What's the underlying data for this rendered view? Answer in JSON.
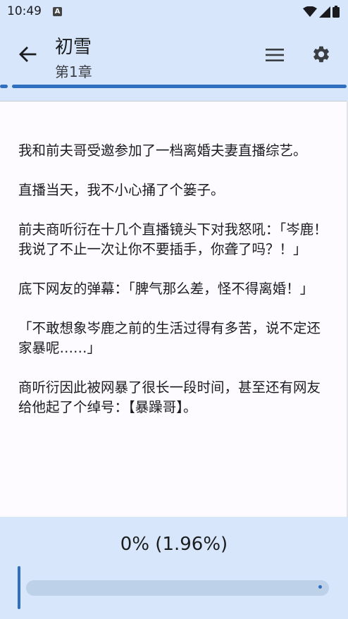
{
  "status_bar": {
    "time": "10:49",
    "notification_badge": "A",
    "icons": [
      "wifi-icon",
      "signal-icon",
      "battery-icon"
    ]
  },
  "header": {
    "title": "初雪",
    "chapter": "第1章",
    "icons": [
      "arrow-left-icon",
      "menu-icon",
      "gear-icon"
    ]
  },
  "content": {
    "paragraphs": [
      "我和前夫哥受邀参加了一档离婚夫妻直播综艺。",
      "直播当天，我不小心捅了个篓子。",
      "前夫商听衍在十几个直播镜头下对我怒吼：「岑鹿！我说了不止一次让你不要插手，你聋了吗？！」",
      "底下网友的弹幕：「脾气那么差，怪不得离婚！」",
      "「不敢想象岑鹿之前的生活过得有多苦，说不定还家暴呢……」",
      "商听衍因此被网暴了很长一段时间，甚至还有网友给他起了个绰号：【暴躁哥】。"
    ]
  },
  "footer": {
    "progress_label": "0% (1.96%)",
    "slider_position": 0
  },
  "colors": {
    "bar_background": "#d7e6fb",
    "accent": "#2f6fbf",
    "page_background": "#fdfbff"
  }
}
